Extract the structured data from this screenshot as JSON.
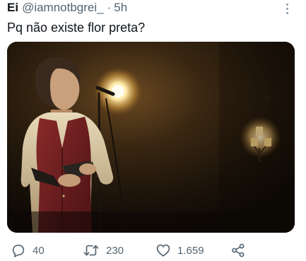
{
  "tweet": {
    "display_name": "Ei",
    "handle": "@iamnotbgrei_",
    "separator": "·",
    "time": "5h",
    "text": "Pq não existe flor preta?"
  },
  "media": {
    "description_icon": "photo"
  },
  "actions": {
    "replies": "40",
    "retweets": "230",
    "likes": "1.659"
  },
  "colors": {
    "text_primary": "#0f1419",
    "text_secondary": "#536471",
    "icon": "#536471"
  }
}
